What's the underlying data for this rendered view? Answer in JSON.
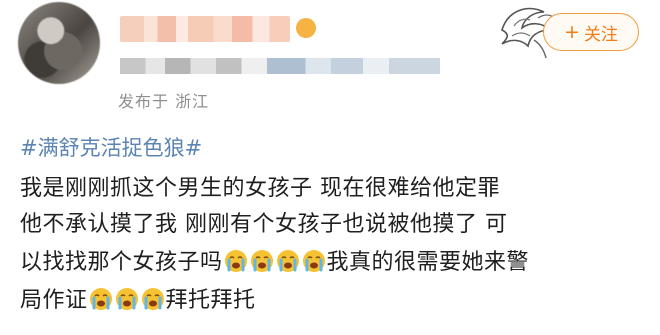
{
  "header": {
    "location": "发布于 浙江",
    "follow_label": "关注",
    "follow_plus": "+"
  },
  "post": {
    "hashtag": "#满舒克活捉色狼#",
    "line1": "我是刚刚抓这个男生的女孩子 现在很难给他定罪",
    "line2": "他不承认摸了我 刚刚有个女孩子也说被他摸了 可",
    "line3_a": "以找找那个女孩子吗",
    "line3_b": "我真的很需要她来警",
    "line4_a": "局作证",
    "line4_b": "拜托拜托"
  },
  "icons": {
    "emoji": "crying-face-icon",
    "follow": "plus-icon",
    "decoration": "dragon-ornament-icon"
  }
}
